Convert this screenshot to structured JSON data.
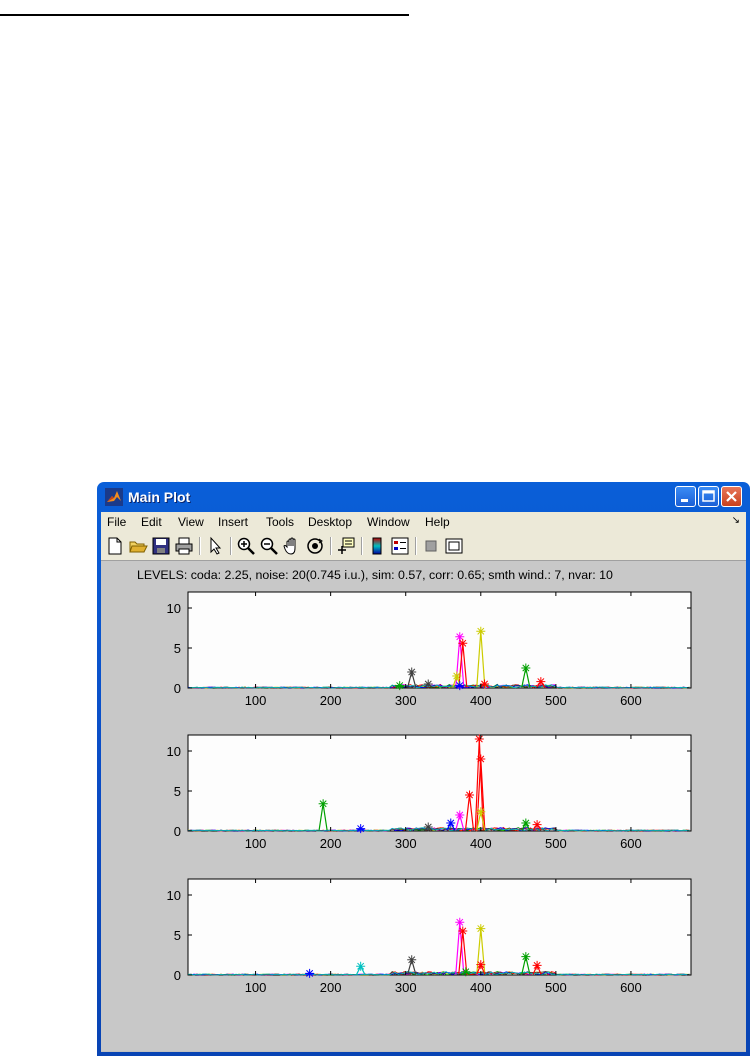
{
  "window": {
    "title": "Main Plot",
    "menu": [
      "File",
      "Edit",
      "View",
      "Insert",
      "Tools",
      "Desktop",
      "Window",
      "Help"
    ],
    "dock_glyph": "↘",
    "toolbar_icons": [
      "new-figure-icon",
      "open-file-icon",
      "save-icon",
      "print-icon",
      "edit-plot-arrow-icon",
      "zoom-in-icon",
      "zoom-out-icon",
      "pan-hand-icon",
      "rotate-3d-icon",
      "data-cursor-icon",
      "colorbar-icon",
      "legend-icon",
      "hide-plot-tools-icon",
      "show-plot-tools-icon"
    ]
  },
  "figure": {
    "title": "LEVELS: coda: 2.25, noise: 20(0.745 i.u.), sim: 0.57, corr: 0.65; smth wind.: 7, nvar: 10"
  },
  "colors": {
    "background": "#c8c8c8",
    "axes_bg": "#fdfdfd",
    "series": [
      "#ff00ff",
      "#cccc00",
      "#00a000",
      "#ff0000",
      "#0000ff",
      "#404040",
      "#00c0c0"
    ]
  },
  "chart_data": [
    {
      "type": "line",
      "xlim": [
        10,
        680
      ],
      "ylim": [
        0,
        12
      ],
      "xticks": [
        100,
        200,
        300,
        400,
        500,
        600
      ],
      "yticks": [
        0,
        5,
        10
      ],
      "grid": false,
      "peaks": [
        {
          "color": "#ff00ff",
          "x": 372,
          "y": 6.4
        },
        {
          "color": "#ff0000",
          "x": 376,
          "y": 5.6
        },
        {
          "color": "#cccc00",
          "x": 368,
          "y": 1.5
        },
        {
          "color": "#cccc00",
          "x": 400,
          "y": 7.1
        },
        {
          "color": "#404040",
          "x": 308,
          "y": 2.0
        },
        {
          "color": "#404040",
          "x": 330,
          "y": 0.5
        },
        {
          "color": "#00a000",
          "x": 460,
          "y": 2.5
        },
        {
          "color": "#00a000",
          "x": 292,
          "y": 0.3
        },
        {
          "color": "#ff0000",
          "x": 480,
          "y": 0.8
        },
        {
          "color": "#0000ff",
          "x": 372,
          "y": 0.3
        },
        {
          "color": "#ff0000",
          "x": 405,
          "y": 0.5
        }
      ]
    },
    {
      "type": "line",
      "xlim": [
        10,
        680
      ],
      "ylim": [
        0,
        12
      ],
      "xticks": [
        100,
        200,
        300,
        400,
        500,
        600
      ],
      "yticks": [
        0,
        5,
        10
      ],
      "grid": false,
      "peaks": [
        {
          "color": "#ff0000",
          "x": 398,
          "y": 11.5
        },
        {
          "color": "#ff0000",
          "x": 400,
          "y": 9.0
        },
        {
          "color": "#ff0000",
          "x": 385,
          "y": 4.5
        },
        {
          "color": "#ff00ff",
          "x": 372,
          "y": 2.0
        },
        {
          "color": "#cccc00",
          "x": 400,
          "y": 2.4
        },
        {
          "color": "#00a000",
          "x": 190,
          "y": 3.4
        },
        {
          "color": "#0000ff",
          "x": 360,
          "y": 1.0
        },
        {
          "color": "#404040",
          "x": 330,
          "y": 0.5
        },
        {
          "color": "#00a000",
          "x": 460,
          "y": 1.0
        },
        {
          "color": "#ff0000",
          "x": 475,
          "y": 0.8
        },
        {
          "color": "#0000ff",
          "x": 240,
          "y": 0.3
        }
      ]
    },
    {
      "type": "line",
      "xlim": [
        10,
        680
      ],
      "ylim": [
        0,
        12
      ],
      "xticks": [
        100,
        200,
        300,
        400,
        500,
        600
      ],
      "yticks": [
        0,
        5,
        10
      ],
      "grid": false,
      "peaks": [
        {
          "color": "#ff00ff",
          "x": 372,
          "y": 6.6
        },
        {
          "color": "#ff0000",
          "x": 376,
          "y": 5.5
        },
        {
          "color": "#cccc00",
          "x": 400,
          "y": 5.8
        },
        {
          "color": "#404040",
          "x": 308,
          "y": 1.9
        },
        {
          "color": "#00c0c0",
          "x": 240,
          "y": 1.1
        },
        {
          "color": "#00a000",
          "x": 460,
          "y": 2.3
        },
        {
          "color": "#ff0000",
          "x": 475,
          "y": 1.2
        },
        {
          "color": "#ff0000",
          "x": 400,
          "y": 1.3
        },
        {
          "color": "#0000ff",
          "x": 172,
          "y": 0.2
        },
        {
          "color": "#00a000",
          "x": 380,
          "y": 0.4
        }
      ]
    }
  ]
}
